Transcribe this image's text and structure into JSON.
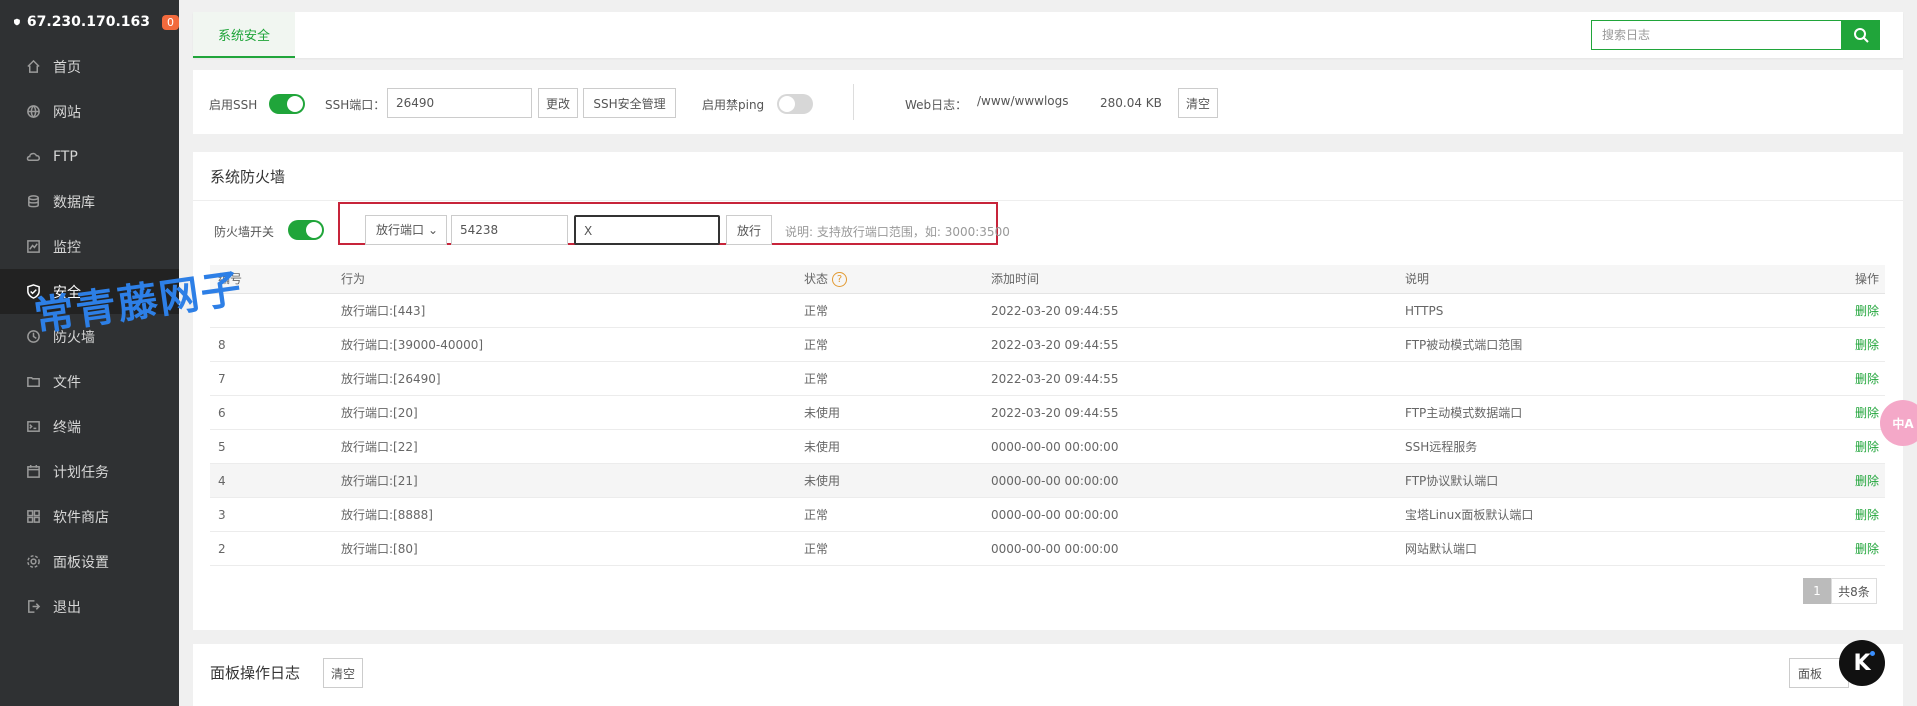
{
  "sidebar": {
    "server_ip": "67.230.170.163",
    "badge": "0",
    "items": [
      {
        "label": "首页",
        "icon": "home-icon"
      },
      {
        "label": "网站",
        "icon": "globe-icon"
      },
      {
        "label": "FTP",
        "icon": "ftp-icon"
      },
      {
        "label": "数据库",
        "icon": "database-icon"
      },
      {
        "label": "监控",
        "icon": "monitor-icon"
      },
      {
        "label": "安全",
        "icon": "shield-icon",
        "active": true
      },
      {
        "label": "防火墙",
        "icon": "firewall-icon"
      },
      {
        "label": "文件",
        "icon": "folder-icon"
      },
      {
        "label": "终端",
        "icon": "terminal-icon"
      },
      {
        "label": "计划任务",
        "icon": "calendar-icon"
      },
      {
        "label": "软件商店",
        "icon": "apps-icon"
      },
      {
        "label": "面板设置",
        "icon": "gear-icon"
      },
      {
        "label": "退出",
        "icon": "logout-icon"
      }
    ]
  },
  "tabs": {
    "active_label": "系统安全",
    "search_placeholder": "搜索日志"
  },
  "ssh": {
    "enable_label": "启用SSH",
    "enabled": true,
    "port_label": "SSH端口：",
    "port_value": "26490",
    "change_btn": "更改",
    "manage_btn": "SSH安全管理",
    "ping_label": "启用禁ping",
    "ping_enabled": false,
    "weblog_label": "Web日志：",
    "weblog_path": "/www/wwwlogs",
    "weblog_size": "280.04 KB",
    "clear_btn": "清空"
  },
  "firewall": {
    "title": "系统防火墙",
    "switch_label": "防火墙开关",
    "enabled": true,
    "type_select": "放行端口",
    "port_input": "54238",
    "note_input": "X",
    "allow_btn": "放行",
    "hint": "说明: 支持放行端口范围，如: 3000:3500",
    "columns": [
      "编号",
      "行为",
      "状态",
      "添加时间",
      "说明",
      "操作"
    ],
    "rows": [
      {
        "id": "",
        "action": "放行端口:[443]",
        "status": "正常",
        "time": "2022-03-20 09:44:55",
        "desc": "HTTPS",
        "op": "删除"
      },
      {
        "id": "8",
        "action": "放行端口:[39000-40000]",
        "status": "正常",
        "time": "2022-03-20 09:44:55",
        "desc": "FTP被动模式端口范围",
        "op": "删除"
      },
      {
        "id": "7",
        "action": "放行端口:[26490]",
        "status": "正常",
        "time": "2022-03-20 09:44:55",
        "desc": "",
        "op": "删除"
      },
      {
        "id": "6",
        "action": "放行端口:[20]",
        "status": "未使用",
        "time": "2022-03-20 09:44:55",
        "desc": "FTP主动模式数据端口",
        "op": "删除"
      },
      {
        "id": "5",
        "action": "放行端口:[22]",
        "status": "未使用",
        "time": "0000-00-00 00:00:00",
        "desc": "SSH远程服务",
        "op": "删除"
      },
      {
        "id": "4",
        "action": "放行端口:[21]",
        "status": "未使用",
        "time": "0000-00-00 00:00:00",
        "desc": "FTP协议默认端口",
        "op": "删除"
      },
      {
        "id": "3",
        "action": "放行端口:[8888]",
        "status": "正常",
        "time": "0000-00-00 00:00:00",
        "desc": "宝塔Linux面板默认端口",
        "op": "删除"
      },
      {
        "id": "2",
        "action": "放行端口:[80]",
        "status": "正常",
        "time": "0000-00-00 00:00:00",
        "desc": "网站默认端口",
        "op": "删除"
      }
    ],
    "page_current": "1",
    "page_total": "共8条"
  },
  "log": {
    "title": "面板操作日志",
    "clear_btn": "清空",
    "right_btn": "面板"
  },
  "overlays": {
    "watermark": "常青藤网子",
    "translate_label": "中A",
    "k_label": "K"
  },
  "colors": {
    "accent": "#20a53a",
    "sidebar_bg": "#2f3133",
    "highlight_border": "#c7243a"
  }
}
